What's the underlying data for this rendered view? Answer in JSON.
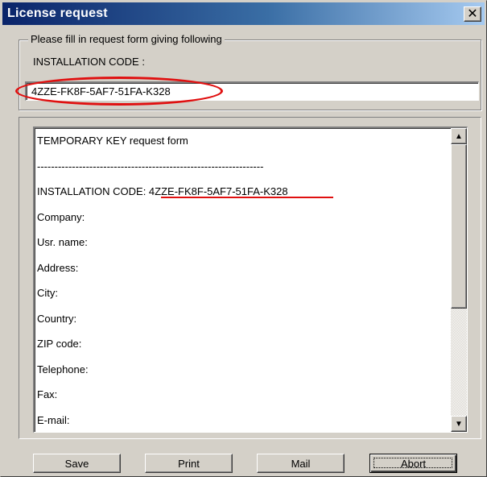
{
  "window": {
    "title": "License request"
  },
  "request_group": {
    "legend": "Please fill in request form giving following",
    "installation_label": "INSTALLATION CODE :",
    "installation_code": "4ZZE-FK8F-5AF7-51FA-K328"
  },
  "form_text": {
    "lines": [
      "TEMPORARY KEY request form",
      "-----------------------------------------------------------------",
      "INSTALLATION CODE: 4ZZE-FK8F-5AF7-51FA-K328",
      "Company:",
      "Usr. name:",
      "Address:",
      "City:",
      "Country:",
      "ZIP code:",
      "Telephone:",
      "Fax:",
      "E-mail:"
    ]
  },
  "buttons": {
    "save": "Save",
    "print": "Print",
    "mail": "Mail",
    "abort": "Abort"
  },
  "annotation_color": "#e01010"
}
